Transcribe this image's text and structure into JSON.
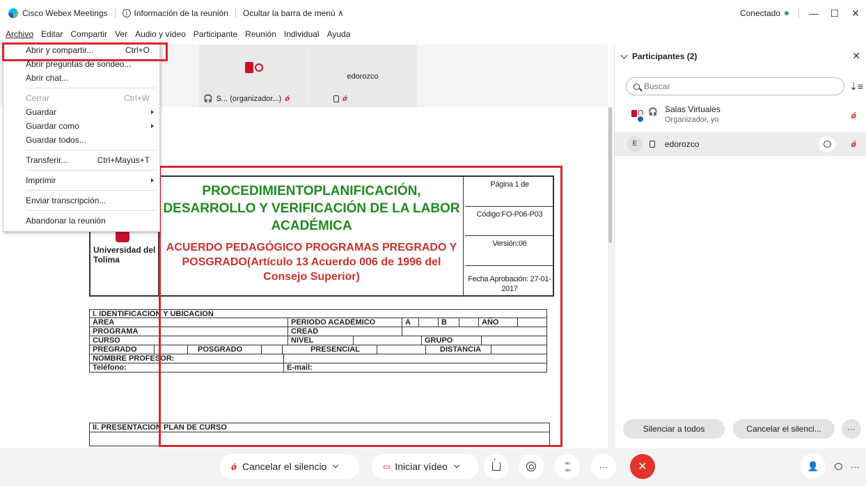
{
  "title_bar": {
    "app_name": "Cisco Webex Meetings",
    "meeting_info": "Información de la reunión",
    "hide_menu": "Ocultar la barra de menú ∧",
    "status": "Conectado",
    "minimize": "—",
    "maximize": "☐",
    "close": "✕"
  },
  "menu_bar": {
    "items": [
      "Archivo",
      "Editar",
      "Compartir",
      "Ver",
      "Audio y vídeo",
      "Participante",
      "Reunión",
      "Individual",
      "Ayuda"
    ]
  },
  "file_menu": {
    "items": [
      {
        "label": "Abrir y compartir...",
        "shortcut": "Ctrl+O"
      },
      {
        "label": "Abrir preguntas de sondeo..."
      },
      {
        "label": "Abrir chat..."
      },
      {
        "label": "Cerrar",
        "shortcut": "Ctrl+W",
        "disabled": true
      },
      {
        "label": "Guardar",
        "submenu": true
      },
      {
        "label": "Guardar como",
        "submenu": true
      },
      {
        "label": "Guardar todos..."
      },
      {
        "label": "Transferir...",
        "shortcut": "Ctrl+Mayús+T"
      },
      {
        "label": "Imprimir",
        "submenu": true
      },
      {
        "label": "Enviar transcripción..."
      },
      {
        "label": "Abandonar la reunión"
      }
    ]
  },
  "video_strip": {
    "tile1_label": "S... (organizador...)",
    "tile2_name": "edorozco"
  },
  "document": {
    "title_green": "PROCEDIMIENTOPLANIFICACIÓN, DESARROLLO Y VERIFICACIÓN DE LA LABOR ACADÉMICA",
    "title_red": "ACUERDO PEDAGÓGICO PROGRAMAS PREGRADO Y POSGRADO(Artículo 13 Acuerdo 006 de 1996 del Consejo Superior)",
    "university": "Universidad del Tolima",
    "page": "Página 1 de",
    "code": "Código:FO-P06-P03",
    "version": "Versión:06",
    "approval": "Fecha Aprobación: 27-01-2017",
    "section1": "I. IDENTIFICACION Y UBICACION",
    "area": "ÁREA",
    "periodo": "PERIODO ACADÉMICO",
    "a": "A",
    "b": "B",
    "anio": "AÑO",
    "programa": "PROGRAMA",
    "cread": "CREAD",
    "curso": "CURSO",
    "nivel": "NIVEL",
    "grupo": "GRUPO",
    "pregrado": "PREGRADO",
    "posgrado": "POSGRADO",
    "presencial": "PRESENCIAL",
    "distancia": "DISTANCIA",
    "profesor": "NOMBRE PROFESOR:",
    "telefono": "Teléfono:",
    "email": "E-mail:",
    "section2": "II. PRESENTACION PLAN DE CURSO"
  },
  "participants_panel": {
    "title": "Participantes (2)",
    "search_placeholder": "Buscar",
    "p1_name": "Salas Virtuales",
    "p1_role": "Organizador, yo",
    "p2_initial": "E",
    "p2_name": "edorozco",
    "mute_all": "Silenciar a todos",
    "unmute_all": "Cancelar el silenci...",
    "more": "···"
  },
  "toolbar": {
    "unmute": "Cancelar el silencio",
    "start_video": "Iniciar vídeo",
    "more": "···",
    "end": "✕"
  }
}
